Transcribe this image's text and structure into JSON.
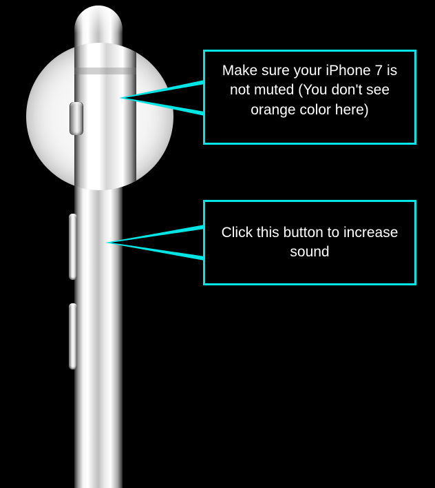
{
  "callouts": {
    "mute": "Make sure your iPhone 7 is not muted (You don't see orange color here)",
    "volume_up": "Click this button to increase sound"
  }
}
